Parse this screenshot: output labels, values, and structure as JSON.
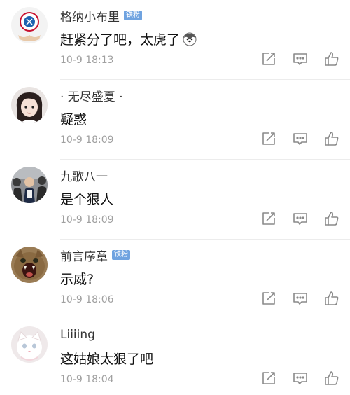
{
  "comments": [
    {
      "name": "格纳小布里",
      "badge": "铁粉",
      "text": "赶紧分了吧，太虎了",
      "time": "10-9 18:13",
      "avatar": "bayern-logo-avatar",
      "emoji": "husky-emoji"
    },
    {
      "name": "· 无尽盛夏 ·",
      "badge": "",
      "text": "疑惑",
      "time": "10-9 18:09",
      "avatar": "girl-photo-avatar",
      "emoji": ""
    },
    {
      "name": "九歌八一",
      "badge": "",
      "text": "是个狠人",
      "time": "10-9 18:09",
      "avatar": "crowd-photo-avatar",
      "emoji": ""
    },
    {
      "name": "前言序章",
      "badge": "铁粉",
      "text": "示威?",
      "time": "10-9 18:06",
      "avatar": "screaming-cat-avatar",
      "emoji": ""
    },
    {
      "name": "Liiiing",
      "badge": "",
      "text": "这姑娘太狠了吧",
      "time": "10-9 18:04",
      "avatar": "white-cat-avatar",
      "emoji": ""
    }
  ],
  "colors": {
    "badge": "#6fa3e0",
    "time": "#a0a0a0",
    "icon": "#8a8a8a"
  },
  "icons": [
    "share-icon",
    "comment-icon",
    "like-icon"
  ]
}
